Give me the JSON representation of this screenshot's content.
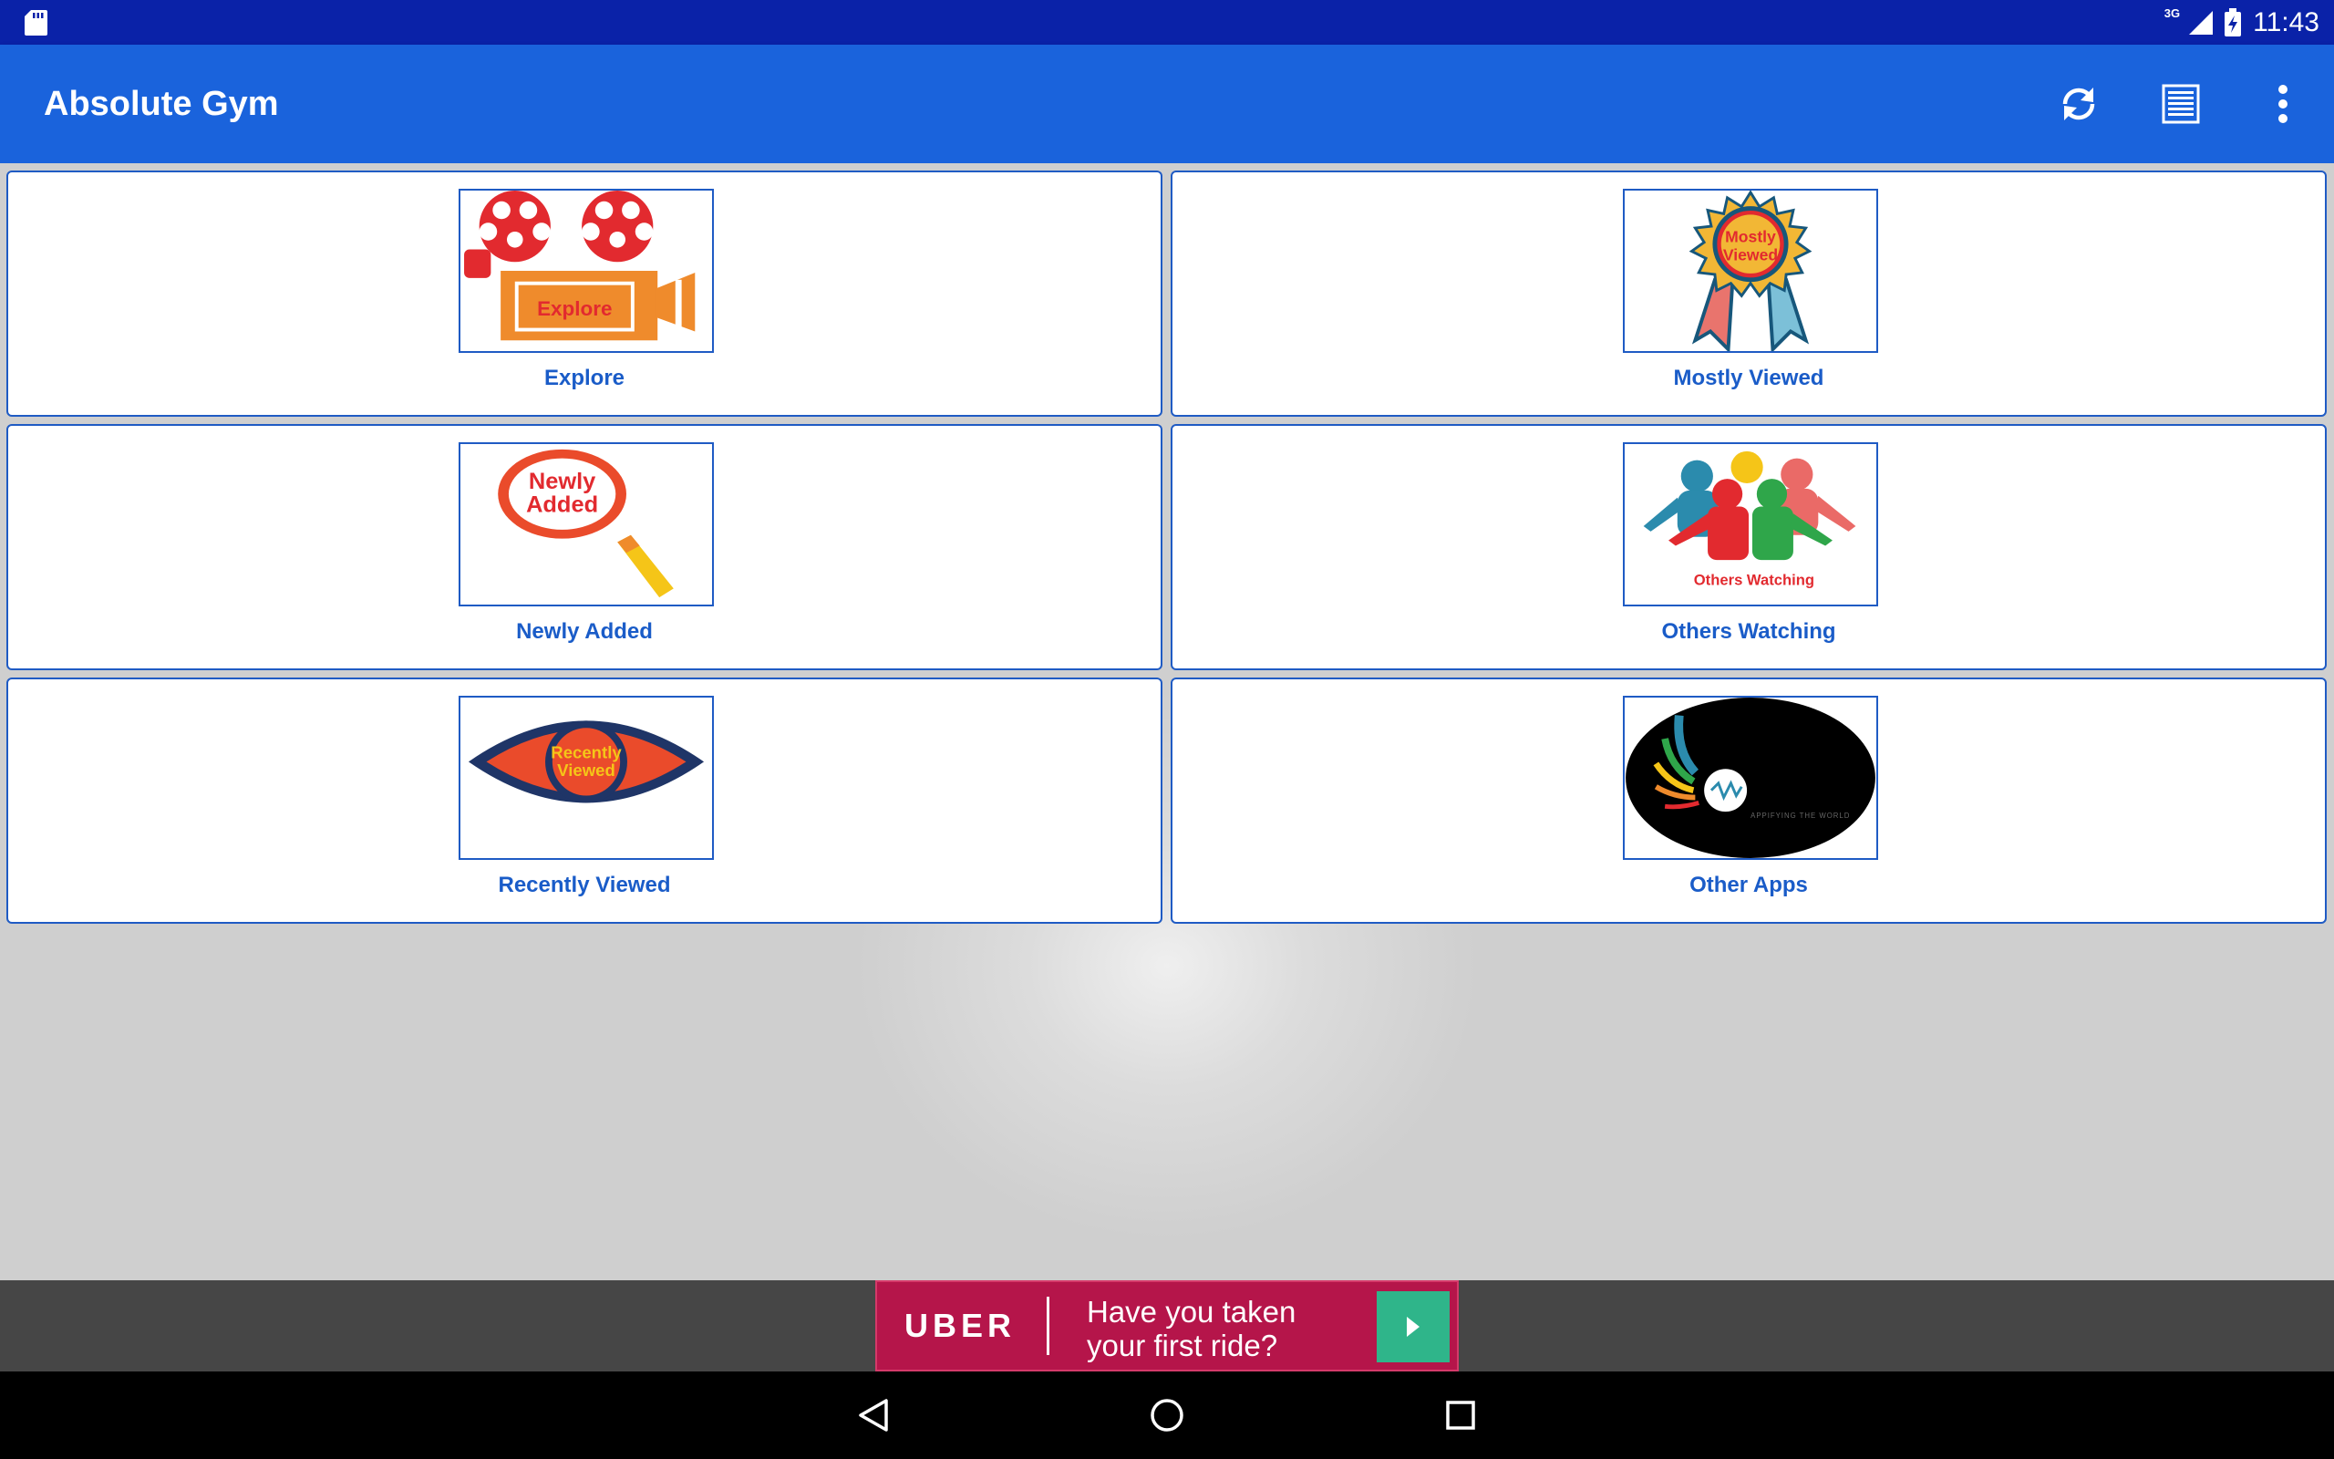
{
  "status_bar": {
    "network": "3G",
    "time": "11:43"
  },
  "app_bar": {
    "title": "Absolute Gym",
    "actions": [
      {
        "icon": "refresh-icon"
      },
      {
        "icon": "list-icon"
      },
      {
        "icon": "more-vert-icon"
      }
    ]
  },
  "tiles": [
    {
      "label": "Explore",
      "image_text": "Explore"
    },
    {
      "label": "Mostly Viewed",
      "image_text": [
        "Mostly",
        "Viewed"
      ]
    },
    {
      "label": "Newly Added",
      "image_text": [
        "Newly",
        "Added"
      ]
    },
    {
      "label": "Others Watching",
      "image_text": "Others Watching"
    },
    {
      "label": "Recently Viewed",
      "image_text": [
        "Recently",
        "Viewed"
      ]
    },
    {
      "label": "Other Apps",
      "image_text": "APPIFYING THE WORLD"
    }
  ],
  "ad": {
    "brand": "UBER",
    "text": "Have you taken your first ride?",
    "colors": {
      "background": "#b5154a",
      "button": "#2fb58a"
    }
  },
  "nav_bar": {
    "buttons": [
      "back-icon",
      "home-icon",
      "recents-icon"
    ]
  },
  "colors": {
    "status_bar": "#0a22a8",
    "app_bar": "#1a63dc",
    "tile_border": "#1f5bc4",
    "label": "#1a5cc8"
  }
}
